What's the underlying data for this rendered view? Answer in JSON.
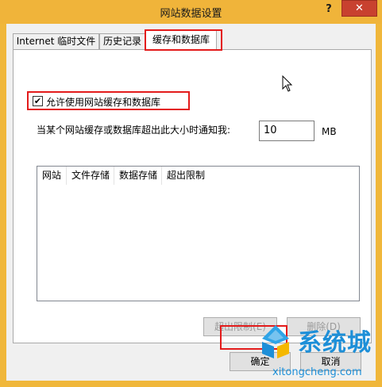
{
  "window": {
    "title": "网站数据设置",
    "help_label": "?",
    "close_label": "✕"
  },
  "tabs": [
    {
      "label": "Internet 临时文件",
      "active": false
    },
    {
      "label": "历史记录",
      "active": false
    },
    {
      "label": "缓存和数据库",
      "active": true
    }
  ],
  "cache": {
    "allow_checkbox_label": "允许使用网站缓存和数据库",
    "allow_checked": true,
    "limit_label": "当某个网站缓存或数据库超出此大小时通知我:",
    "limit_value": "10",
    "limit_unit": "MB"
  },
  "site_list": {
    "columns": [
      "网站",
      "文件存储",
      "数据存储",
      "超出限制"
    ],
    "rows": []
  },
  "list_buttons": {
    "exceed_limit_label": "超出限制(E)",
    "delete_label": "删除(D)"
  },
  "dialog_buttons": {
    "ok_label": "确定",
    "cancel_label": "取消"
  },
  "watermark": {
    "title": "系统城",
    "url": "xitongcheng.com"
  },
  "colors": {
    "title_bar": "#f0b43a",
    "close_button": "#c8412f",
    "highlight_red": "#e31b1b",
    "watermark_blue": "#1d8fd8"
  }
}
